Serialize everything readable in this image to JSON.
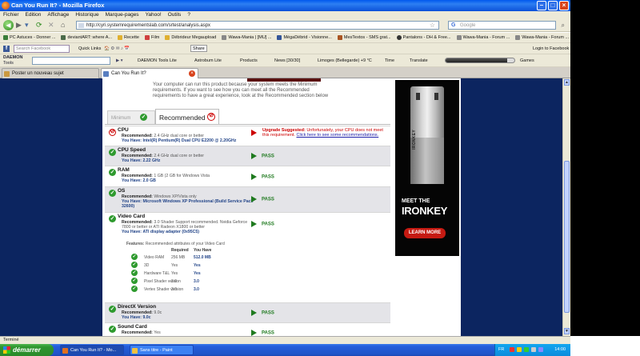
{
  "window": {
    "title": "Can You Run It? - Mozilla Firefox"
  },
  "menu": [
    "Fichier",
    "Edition",
    "Affichage",
    "Historique",
    "Marque-pages",
    "Yahoo!",
    "Outils",
    "?"
  ],
  "nav": {
    "url": "http://cyri.systemrequirementslab.com/srtest/analysis.aspx",
    "search_placeholder": "Google"
  },
  "bookmarks": [
    {
      "label": "PC Astuces - Donner ...",
      "color": "#3a7d3a"
    },
    {
      "label": "deviantART: where A...",
      "color": "#4a6a4a"
    },
    {
      "label": "Recette",
      "color": "#e0b030"
    },
    {
      "label": "Film",
      "color": "#d04040"
    },
    {
      "label": "Débrideur Megaupload",
      "color": "#e0b030"
    },
    {
      "label": "Wawa-Mania | [MU] ...",
      "color": "#888"
    },
    {
      "label": "MégaDébrid - Visionne...",
      "color": "#335599"
    },
    {
      "label": "MesTextos - SMS grat...",
      "color": "#aa5522"
    },
    {
      "label": "Pantalons - DH & Free...",
      "color": "#333"
    },
    {
      "label": "Wawa-Mania - Forum ...",
      "color": "#888"
    },
    {
      "label": "Wawa-Mania - Forum ...",
      "color": "#888"
    }
  ],
  "toolbar1": {
    "search_placeholder": "Search Facebook",
    "quick_links": "Quick Links",
    "share": "Share",
    "login": "Login to Facebook"
  },
  "toolbar2": {
    "daemon": "DAEMON",
    "daemon_sub": "Tools",
    "daemon_tools": "DAEMON Tools Lite",
    "astrobum": "Astrobum Lite",
    "products": "Products",
    "news": "News [30/30]",
    "weather": "Limoges (Bellegarde) +9 °C",
    "time": "Time",
    "translate": "Translate",
    "games": "Games",
    "media_progress": 0.9
  },
  "tabs": [
    {
      "label": "Poster un nouveau sujet",
      "active": false
    },
    {
      "label": "Can You Run It?",
      "active": true
    }
  ],
  "page": {
    "intro": "Your computer can run this product because your system meets the Minimum requirements. If you want to see how you can meet all the Recommended requirements to have a great experience, look at the Recommended section below",
    "tab_minimum": "Minimum",
    "tab_recommended": "Recommended",
    "rows": [
      {
        "name": "CPU",
        "rec_label": "Recommended:",
        "rec": "2.4 GHz dual core or better",
        "have_label": "You Have:",
        "have": "Intel(R) Pentium(R) Dual CPU E2200 @ 2.20GHz",
        "status": "fail",
        "upgrade_title": "Upgrade Suggested:",
        "upgrade_text": "Unfortunately, your CPU does not meet this requirement.",
        "upgrade_link": "Click here to see some recommendations."
      },
      {
        "name": "CPU Speed",
        "rec_label": "Recommended:",
        "rec": "2.4 GHz dual core or better",
        "have_label": "You Have:",
        "have": "2.22 GHz",
        "status": "pass",
        "result": "PASS"
      },
      {
        "name": "RAM",
        "rec_label": "Recommended:",
        "rec": "1 GB (2 GB for Windows Vista",
        "have_label": "You Have:",
        "have": "2.0 GB",
        "status": "pass",
        "result": "PASS"
      },
      {
        "name": "OS",
        "rec_label": "Recommended:",
        "rec": "Windows XP/Vista only",
        "have_label": "You Have:",
        "have": "Microsoft Windows XP Professional (Build Service Pack 32600)",
        "status": "pass",
        "result": "PASS"
      },
      {
        "name": "Video Card",
        "rec_label": "Recommended:",
        "rec": "3.0 Shader Support recommended. Nvidia Geforce 7800 or better or ATI Radeon X1800 or better",
        "have_label": "You Have:",
        "have": "ATI display adapter (0x95C5)",
        "status": "pass",
        "result": "PASS"
      },
      {
        "name": "DirectX Version",
        "rec_label": "Recommended:",
        "rec": "9.0c",
        "have_label": "You Have:",
        "have": "9.0c",
        "status": "pass",
        "result": "PASS"
      },
      {
        "name": "Sound Card",
        "rec_label": "Recommended:",
        "rec": "Yes",
        "have_label": "",
        "have": "",
        "status": "pass",
        "result": "PASS"
      }
    ],
    "features": {
      "label": "Features:",
      "desc": "Recommended attributes of your Video Card",
      "col_required": "Required",
      "col_have": "You Have",
      "items": [
        {
          "name": "Video RAM",
          "required": "256 MB",
          "have": "512.0 MB"
        },
        {
          "name": "3D",
          "required": "Yes",
          "have": "Yes"
        },
        {
          "name": "Hardware T&L",
          "required": "Yes",
          "have": "Yes"
        },
        {
          "name": "Pixel Shader version",
          "required": "3.0",
          "have": "3.0"
        },
        {
          "name": "Vertex Shader version",
          "required": "3.0",
          "have": "3.0"
        }
      ]
    },
    "ad": {
      "brand": "IRONKEY",
      "line1": "MEET THE",
      "line2": "IRONKEY",
      "button": "LEARN MORE"
    }
  },
  "status": "Terminé",
  "taskbar": {
    "start": "démarrer",
    "items": [
      {
        "label": "Can You Run It? - Mo...",
        "active": true
      },
      {
        "label": "Sans titre - Paint",
        "active": false
      }
    ],
    "lang": "FR",
    "clock": "14:00"
  }
}
